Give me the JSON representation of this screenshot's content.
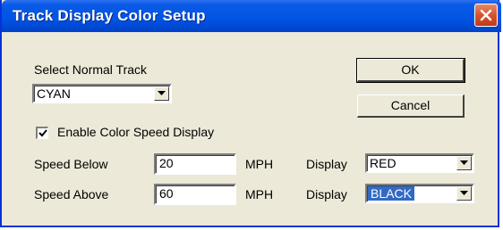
{
  "window": {
    "title": "Track Display Color Setup"
  },
  "normal_track": {
    "label": "Select Normal Track",
    "value": "CYAN"
  },
  "buttons": {
    "ok": "OK",
    "cancel": "Cancel"
  },
  "color_speed": {
    "label": "Enable Color Speed Display",
    "checked": true
  },
  "speed_below": {
    "label": "Speed Below",
    "value": "20",
    "unit": "MPH",
    "display_label": "Display",
    "display_value": "RED"
  },
  "speed_above": {
    "label": "Speed Above",
    "value": "60",
    "unit": "MPH",
    "display_label": "Display",
    "display_value": "BLACK"
  },
  "icons": {
    "close": "close-icon",
    "dropdown": "chevron-down-icon",
    "check": "check-icon"
  },
  "colors": {
    "title_bar": "#0054e3",
    "close_button": "#d4542c",
    "dialog_bg": "#ece9d8",
    "selection": "#316ac5"
  }
}
